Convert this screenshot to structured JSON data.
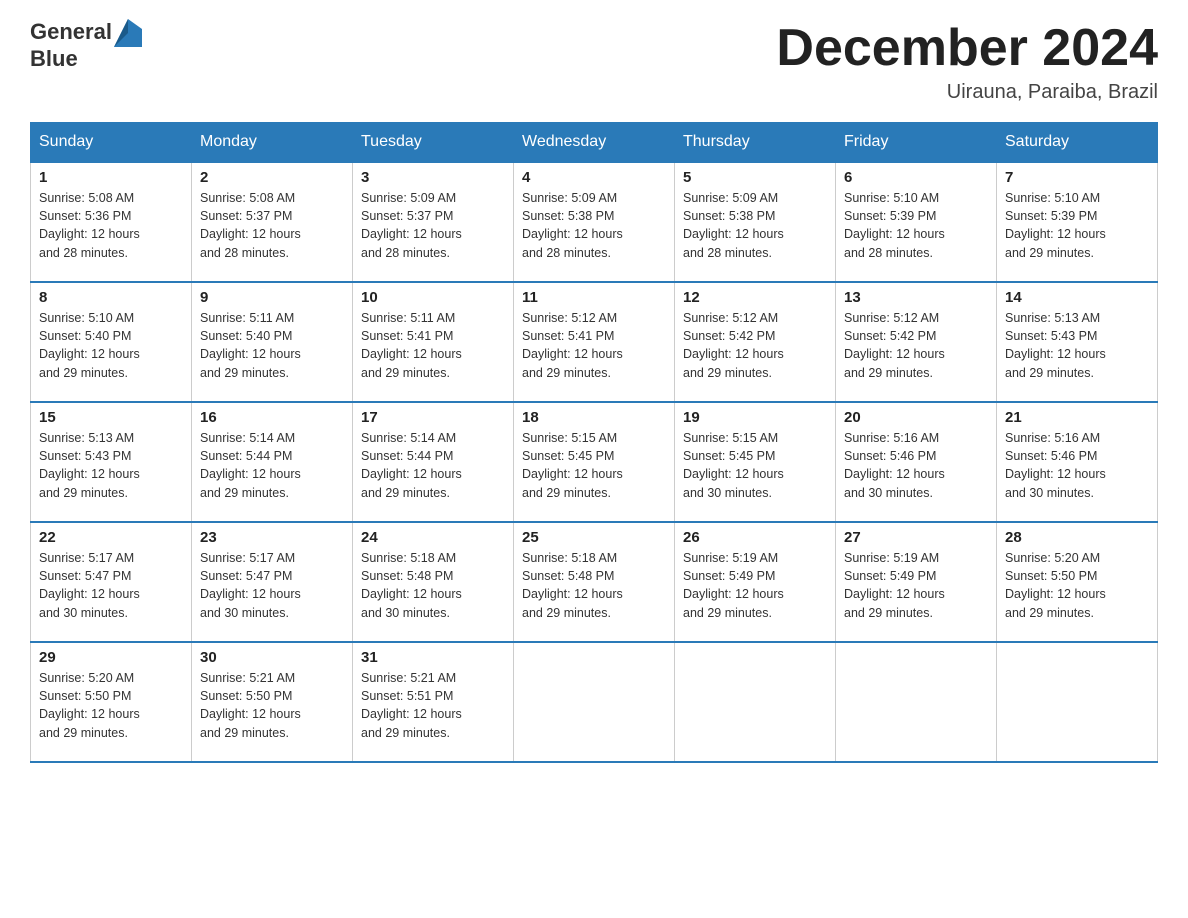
{
  "header": {
    "logo_text_general": "General",
    "logo_text_blue": "Blue",
    "month_title": "December 2024",
    "subtitle": "Uirauna, Paraiba, Brazil"
  },
  "days_of_week": [
    "Sunday",
    "Monday",
    "Tuesday",
    "Wednesday",
    "Thursday",
    "Friday",
    "Saturday"
  ],
  "weeks": [
    [
      {
        "day": "1",
        "sunrise": "5:08 AM",
        "sunset": "5:36 PM",
        "daylight": "12 hours and 28 minutes."
      },
      {
        "day": "2",
        "sunrise": "5:08 AM",
        "sunset": "5:37 PM",
        "daylight": "12 hours and 28 minutes."
      },
      {
        "day": "3",
        "sunrise": "5:09 AM",
        "sunset": "5:37 PM",
        "daylight": "12 hours and 28 minutes."
      },
      {
        "day": "4",
        "sunrise": "5:09 AM",
        "sunset": "5:38 PM",
        "daylight": "12 hours and 28 minutes."
      },
      {
        "day": "5",
        "sunrise": "5:09 AM",
        "sunset": "5:38 PM",
        "daylight": "12 hours and 28 minutes."
      },
      {
        "day": "6",
        "sunrise": "5:10 AM",
        "sunset": "5:39 PM",
        "daylight": "12 hours and 28 minutes."
      },
      {
        "day": "7",
        "sunrise": "5:10 AM",
        "sunset": "5:39 PM",
        "daylight": "12 hours and 29 minutes."
      }
    ],
    [
      {
        "day": "8",
        "sunrise": "5:10 AM",
        "sunset": "5:40 PM",
        "daylight": "12 hours and 29 minutes."
      },
      {
        "day": "9",
        "sunrise": "5:11 AM",
        "sunset": "5:40 PM",
        "daylight": "12 hours and 29 minutes."
      },
      {
        "day": "10",
        "sunrise": "5:11 AM",
        "sunset": "5:41 PM",
        "daylight": "12 hours and 29 minutes."
      },
      {
        "day": "11",
        "sunrise": "5:12 AM",
        "sunset": "5:41 PM",
        "daylight": "12 hours and 29 minutes."
      },
      {
        "day": "12",
        "sunrise": "5:12 AM",
        "sunset": "5:42 PM",
        "daylight": "12 hours and 29 minutes."
      },
      {
        "day": "13",
        "sunrise": "5:12 AM",
        "sunset": "5:42 PM",
        "daylight": "12 hours and 29 minutes."
      },
      {
        "day": "14",
        "sunrise": "5:13 AM",
        "sunset": "5:43 PM",
        "daylight": "12 hours and 29 minutes."
      }
    ],
    [
      {
        "day": "15",
        "sunrise": "5:13 AM",
        "sunset": "5:43 PM",
        "daylight": "12 hours and 29 minutes."
      },
      {
        "day": "16",
        "sunrise": "5:14 AM",
        "sunset": "5:44 PM",
        "daylight": "12 hours and 29 minutes."
      },
      {
        "day": "17",
        "sunrise": "5:14 AM",
        "sunset": "5:44 PM",
        "daylight": "12 hours and 29 minutes."
      },
      {
        "day": "18",
        "sunrise": "5:15 AM",
        "sunset": "5:45 PM",
        "daylight": "12 hours and 29 minutes."
      },
      {
        "day": "19",
        "sunrise": "5:15 AM",
        "sunset": "5:45 PM",
        "daylight": "12 hours and 30 minutes."
      },
      {
        "day": "20",
        "sunrise": "5:16 AM",
        "sunset": "5:46 PM",
        "daylight": "12 hours and 30 minutes."
      },
      {
        "day": "21",
        "sunrise": "5:16 AM",
        "sunset": "5:46 PM",
        "daylight": "12 hours and 30 minutes."
      }
    ],
    [
      {
        "day": "22",
        "sunrise": "5:17 AM",
        "sunset": "5:47 PM",
        "daylight": "12 hours and 30 minutes."
      },
      {
        "day": "23",
        "sunrise": "5:17 AM",
        "sunset": "5:47 PM",
        "daylight": "12 hours and 30 minutes."
      },
      {
        "day": "24",
        "sunrise": "5:18 AM",
        "sunset": "5:48 PM",
        "daylight": "12 hours and 30 minutes."
      },
      {
        "day": "25",
        "sunrise": "5:18 AM",
        "sunset": "5:48 PM",
        "daylight": "12 hours and 29 minutes."
      },
      {
        "day": "26",
        "sunrise": "5:19 AM",
        "sunset": "5:49 PM",
        "daylight": "12 hours and 29 minutes."
      },
      {
        "day": "27",
        "sunrise": "5:19 AM",
        "sunset": "5:49 PM",
        "daylight": "12 hours and 29 minutes."
      },
      {
        "day": "28",
        "sunrise": "5:20 AM",
        "sunset": "5:50 PM",
        "daylight": "12 hours and 29 minutes."
      }
    ],
    [
      {
        "day": "29",
        "sunrise": "5:20 AM",
        "sunset": "5:50 PM",
        "daylight": "12 hours and 29 minutes."
      },
      {
        "day": "30",
        "sunrise": "5:21 AM",
        "sunset": "5:50 PM",
        "daylight": "12 hours and 29 minutes."
      },
      {
        "day": "31",
        "sunrise": "5:21 AM",
        "sunset": "5:51 PM",
        "daylight": "12 hours and 29 minutes."
      },
      null,
      null,
      null,
      null
    ]
  ],
  "labels": {
    "sunrise": "Sunrise:",
    "sunset": "Sunset:",
    "daylight": "Daylight:"
  }
}
